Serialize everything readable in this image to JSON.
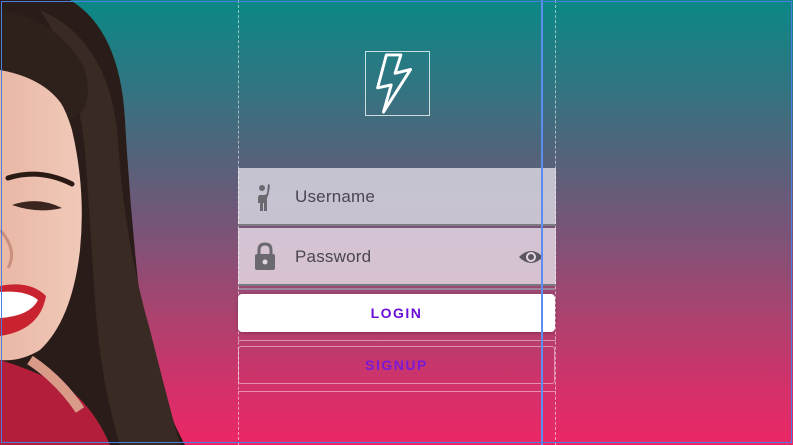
{
  "form": {
    "username": {
      "placeholder": "Username",
      "icon": "person-waving-icon"
    },
    "password": {
      "placeholder": "Password",
      "icon": "lock-icon",
      "toggle_icon": "eye-icon"
    },
    "login_label": "LOGIN",
    "signup_label": "SIGNUP"
  },
  "logo": {
    "icon": "lightning-bolt-icon"
  },
  "colors": {
    "gradient_top": "#0b8886",
    "gradient_bottom": "#ec2765",
    "button_text": "#6a10d8",
    "selection_guide": "#5b8ef0"
  }
}
